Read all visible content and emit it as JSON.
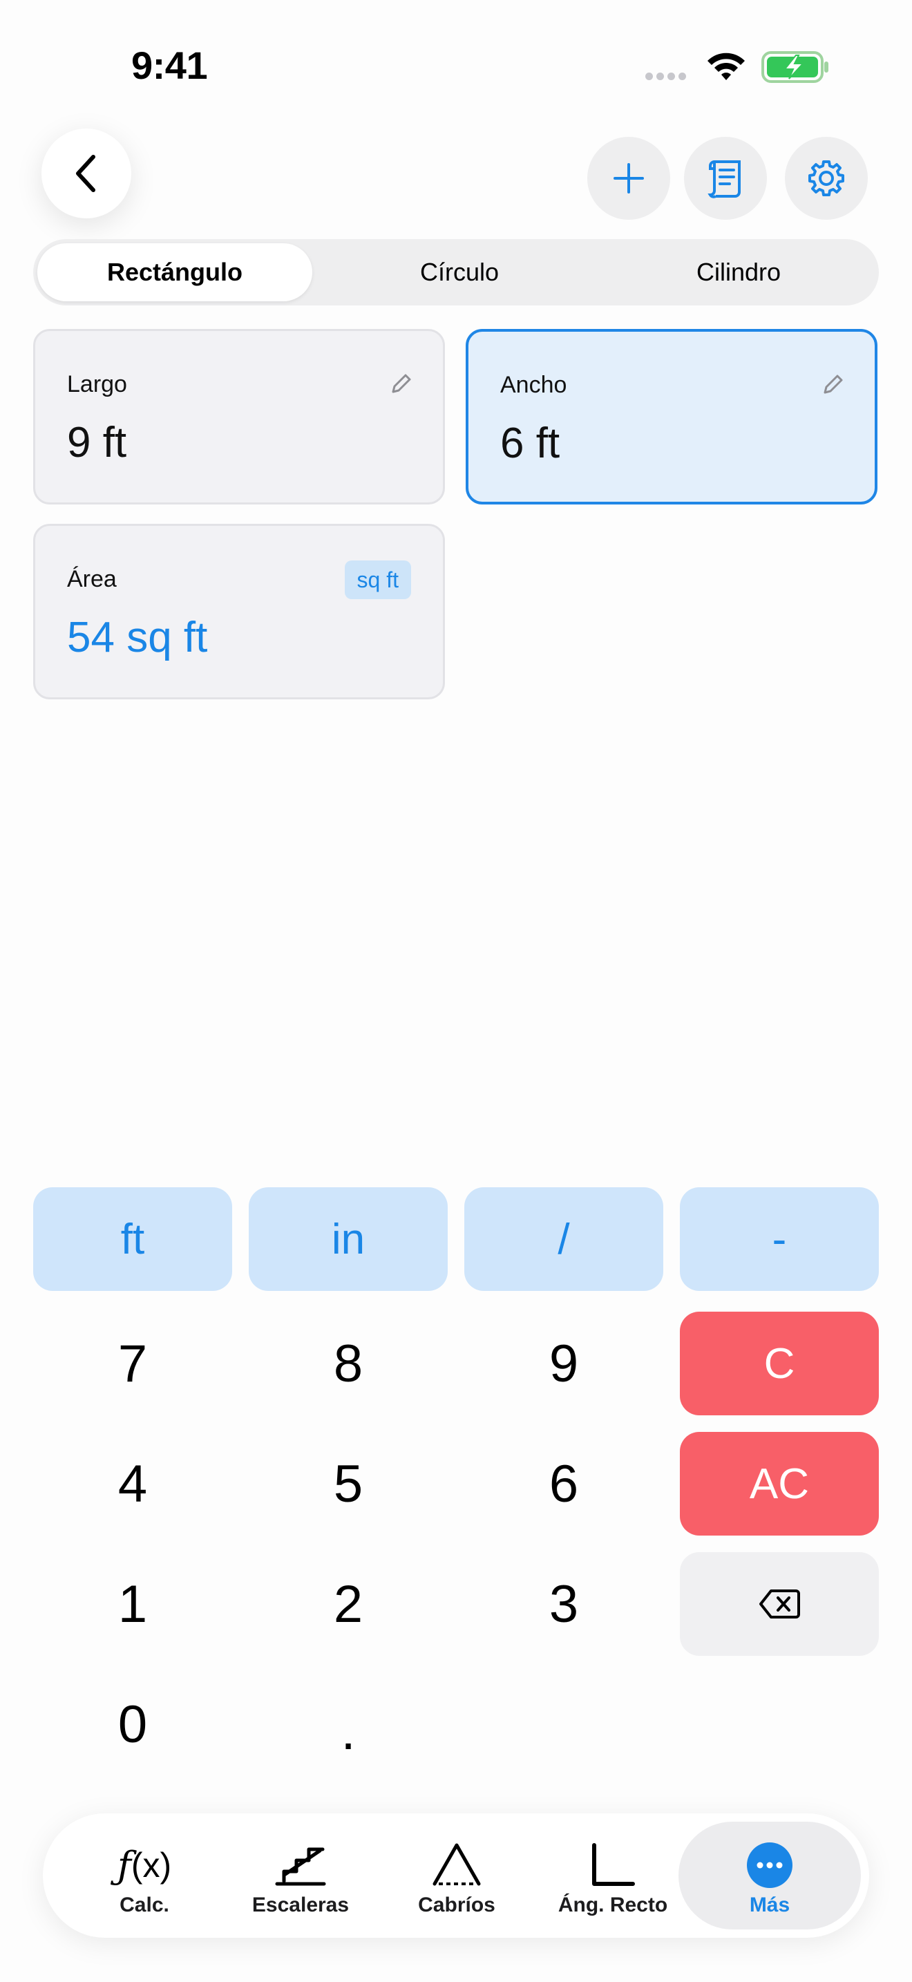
{
  "status_bar": {
    "time": "9:41"
  },
  "header": {
    "back_icon": "chevron-left-icon",
    "actions": [
      "plus-icon",
      "scroll-icon",
      "gear-icon"
    ]
  },
  "segments": {
    "items": [
      "Rectángulo",
      "Círculo",
      "Cilindro"
    ],
    "selected": "Rectángulo"
  },
  "fields": {
    "largo": {
      "label": "Largo",
      "value": "9 ft"
    },
    "ancho": {
      "label": "Ancho",
      "value": "6 ft"
    },
    "area": {
      "label": "Área",
      "value": "54 sq ft",
      "unit": "sq ft"
    }
  },
  "keypad": {
    "units": [
      "ft",
      "in",
      "/",
      "-"
    ],
    "row1": [
      "7",
      "8",
      "9"
    ],
    "row2": [
      "4",
      "5",
      "6"
    ],
    "row3": [
      "1",
      "2",
      "3"
    ],
    "row4": [
      "0",
      "."
    ],
    "clear": "C",
    "all_clear": "AC",
    "backspace_icon": "backspace-icon"
  },
  "tabs": [
    {
      "label": "Calc.",
      "icon": "function-icon"
    },
    {
      "label": "Escaleras",
      "icon": "stairs-icon"
    },
    {
      "label": "Cabríos",
      "icon": "rafter-icon"
    },
    {
      "label": "Áng. Recto",
      "icon": "right-angle-icon"
    },
    {
      "label": "Más",
      "icon": "more-icon"
    }
  ],
  "colors": {
    "accent": "#1a86e6",
    "danger": "#f85f68",
    "selected_card": "#e3effb"
  }
}
